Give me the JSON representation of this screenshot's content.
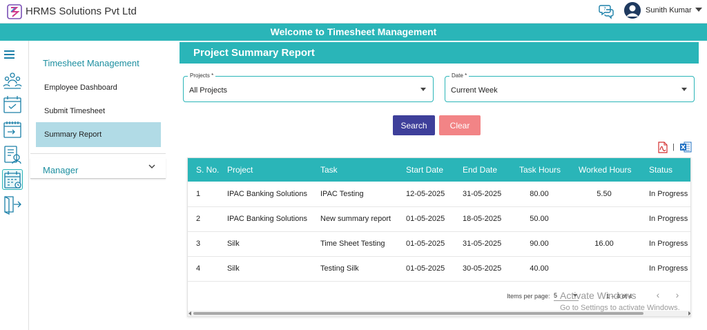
{
  "header": {
    "brand": "HRMS Solutions Pvt Ltd",
    "user_name": "Sunith Kumar",
    "help_icon": "help-chat-icon",
    "avatar_icon": "user-avatar-icon"
  },
  "banner": {
    "title": "Welcome to Timesheet Management"
  },
  "rail": {
    "icons": [
      "menu-icon",
      "team-icon",
      "calendar-check-icon",
      "timesheet-entry-icon",
      "employee-report-icon",
      "summary-calendar-icon",
      "logout-icon"
    ],
    "active_index": 5
  },
  "sidebar": {
    "title": "Timesheet Management",
    "items": [
      {
        "label": "Employee Dashboard"
      },
      {
        "label": "Submit Timesheet"
      },
      {
        "label": "Summary Report",
        "active": true
      }
    ],
    "manager_label": "Manager"
  },
  "report": {
    "title": "Project Summary Report",
    "projects_field": {
      "label": "Projects *",
      "value": "All Projects"
    },
    "date_field": {
      "label": "Date *",
      "value": "Current Week"
    },
    "search_label": "Search",
    "clear_label": "Clear",
    "export_separator": "|"
  },
  "table": {
    "headers": [
      "S. No.",
      "Project",
      "Task",
      "Start Date",
      "End Date",
      "Task Hours",
      "Worked Hours",
      "Status"
    ],
    "rows": [
      [
        "1",
        "IPAC Banking Solutions",
        "IPAC Testing",
        "12-05-2025",
        "31-05-2025",
        "80.00",
        "5.50",
        "In Progress"
      ],
      [
        "2",
        "IPAC Banking Solutions",
        "New summary report",
        "01-05-2025",
        "18-05-2025",
        "50.00",
        "",
        "In Progress"
      ],
      [
        "3",
        "Silk",
        "Time Sheet Testing",
        "01-05-2025",
        "31-05-2025",
        "90.00",
        "16.00",
        "In Progress"
      ],
      [
        "4",
        "Silk",
        "Testing Silk",
        "01-05-2025",
        "30-05-2025",
        "40.00",
        "",
        "In Progress"
      ]
    ]
  },
  "paginator": {
    "label": "Items per page:",
    "page_size": "5",
    "range": "1 – 4 of 4",
    "prev_icon": "chevron-left-icon",
    "next_icon": "chevron-right-icon"
  },
  "watermark": {
    "line1": "Activate Windows",
    "line2": "Go to Settings to activate Windows."
  },
  "colors": {
    "accent": "#2ab5b8",
    "search_button": "#3e3f9a",
    "clear_button": "#f28486",
    "sidebar_active": "#b1dbe6",
    "sidebar_title": "#1d8fa0"
  }
}
